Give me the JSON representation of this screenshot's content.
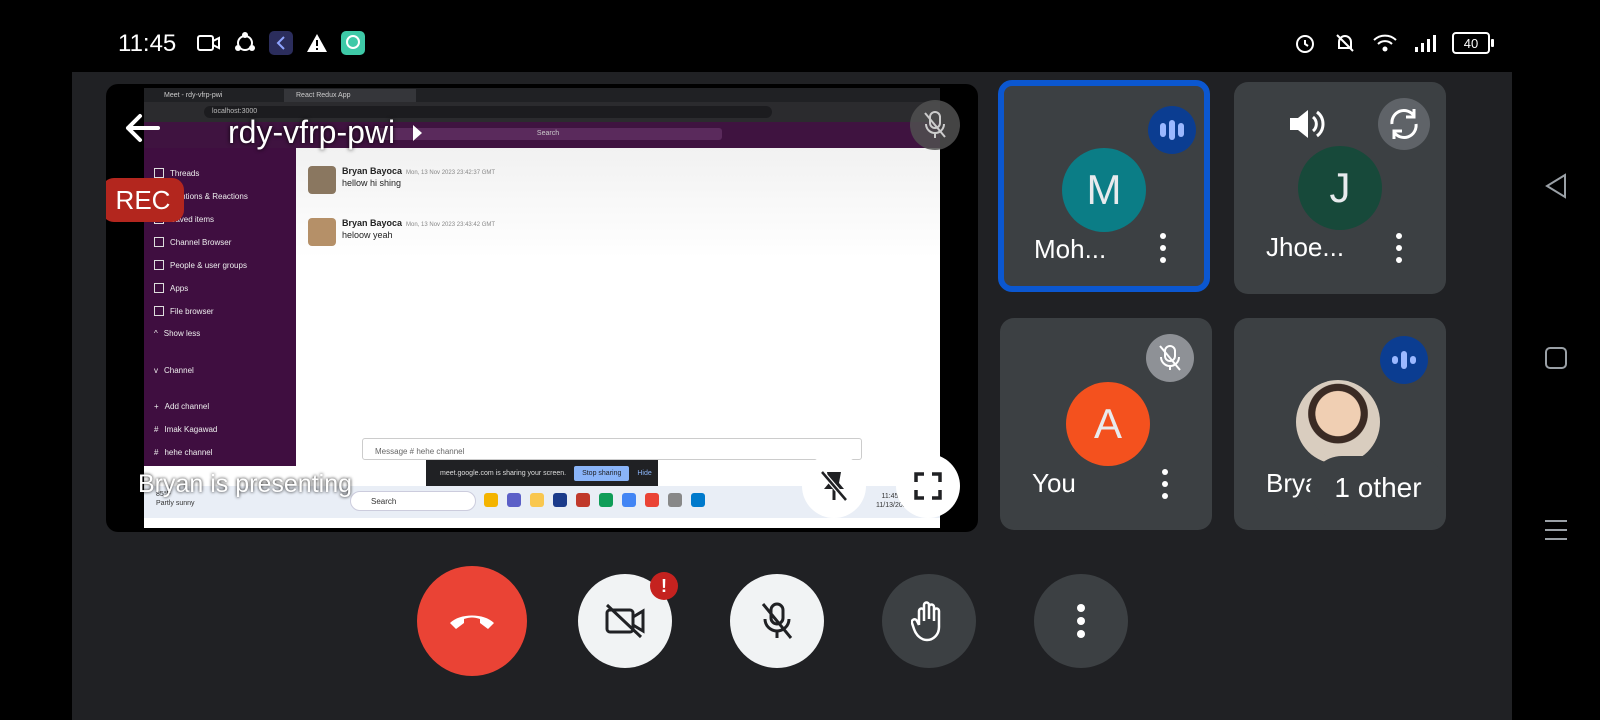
{
  "status_bar": {
    "time": "11:45",
    "left_icons": [
      "video-camera-icon",
      "share-network-icon",
      "app-k-icon",
      "warning-icon",
      "chat-bubble-icon"
    ],
    "right_icons": [
      "alarm-icon",
      "notifications-off-icon",
      "wifi-icon",
      "signal-icon"
    ],
    "battery": "40"
  },
  "presentation": {
    "meeting_code": "rdy-vfrp-pwi",
    "recording_label": "REC",
    "presenting_text": "Bryan is presenting",
    "shared_screen": {
      "tabs": [
        "Meet - rdy-vfrp-pwi",
        "React Redux App"
      ],
      "url": "localhost:3000",
      "search_placeholder": "Search",
      "sidebar_items": [
        "Threads",
        "Mentions & Reactions",
        "Saved items",
        "Channel Browser",
        "People & user groups",
        "Apps",
        "File browser",
        "Show less",
        "Channel",
        "Add channel",
        "Imak Kagawad",
        "hehe channel"
      ],
      "messages": [
        {
          "author": "Bryan Bayoca",
          "meta": "Mon, 13 Nov 2023 23:42:37 GMT",
          "text": "hellow hi shing"
        },
        {
          "author": "Bryan Bayoca",
          "meta": "Mon, 13 Nov 2023 23:43:42 GMT",
          "text": "heloow yeah"
        }
      ],
      "composer_placeholder": "Message # hehe channel",
      "share_notice": "meet.google.com is sharing your screen.",
      "stop_sharing": "Stop sharing",
      "hide": "Hide",
      "taskbar": {
        "weather_temp": "85°F",
        "weather_desc": "Partly sunny",
        "search": "Search",
        "clock_time": "11:45 AM",
        "clock_date": "11/13/2023"
      }
    }
  },
  "participants": [
    {
      "name": "Moh...",
      "initial": "M",
      "color": "#0b7d86",
      "status": "speaking",
      "active": true
    },
    {
      "name": "Jhoe...",
      "initial": "J",
      "color": "#17493a",
      "status": "none",
      "active": false
    },
    {
      "name": "You",
      "initial": "A",
      "color": "#f4511e",
      "status": "muted",
      "active": false
    },
    {
      "name": "Bryan",
      "initial": "",
      "color": "",
      "status": "speaking",
      "active": false,
      "others": "1 other"
    }
  ],
  "controls": {
    "end_call": "end-call-icon",
    "camera": "camera-off-icon",
    "camera_warning": "!",
    "microphone": "mic-off-icon",
    "raise_hand": "raise-hand-icon",
    "more": "more-vert-icon"
  },
  "colors": {
    "end_call": "#ea4335",
    "active_border": "#0b57d0",
    "rec": "#b3261e",
    "tile_bg": "#3c4043",
    "speaking_badge": "#0b3d91"
  }
}
